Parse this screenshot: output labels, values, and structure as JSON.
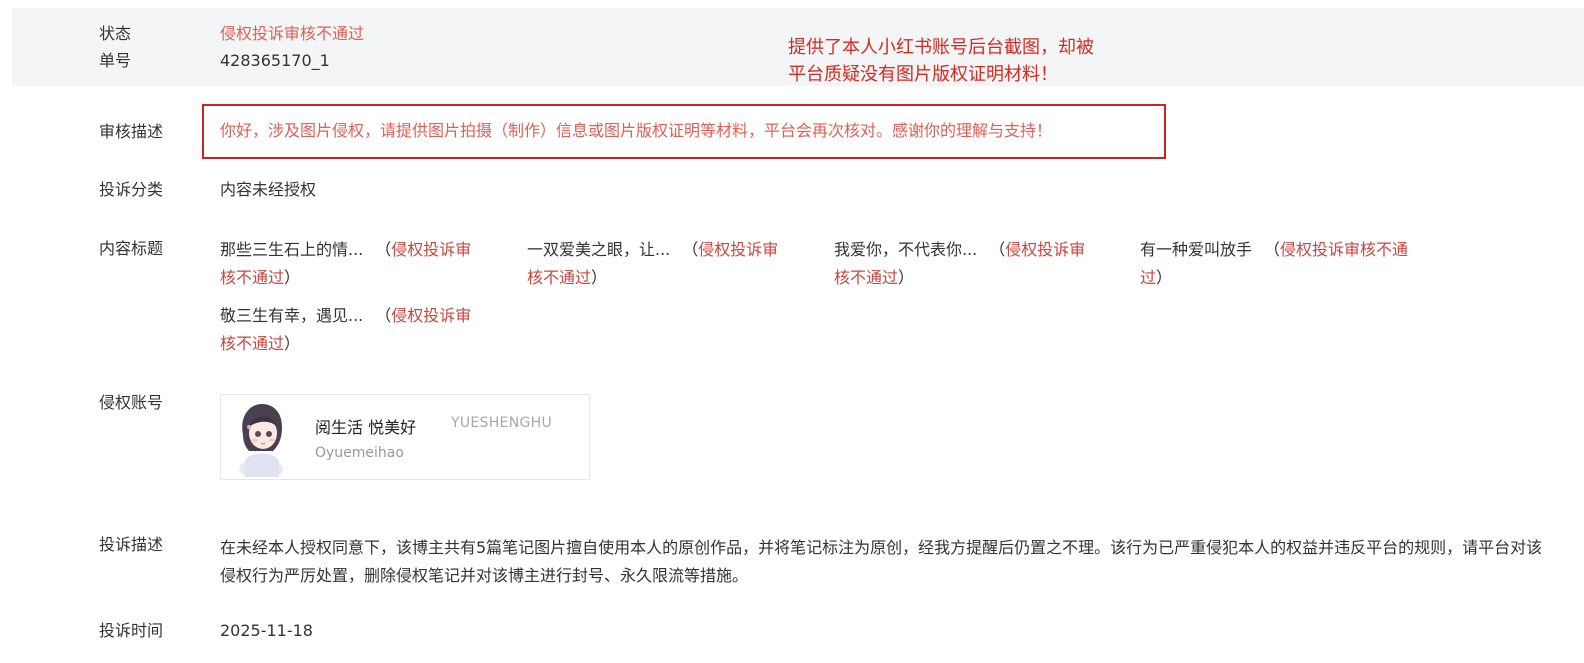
{
  "header": {
    "status_label": "状态",
    "status_value": "侵权投诉审核不通过",
    "order_label": "单号",
    "order_value": "428365170_1",
    "annotation_line1": "提供了本人小红书账号后台截图，却被",
    "annotation_line2": "平台质疑没有图片版权证明材料！"
  },
  "review": {
    "label": "审核描述",
    "text": "你好，涉及图片侵权，请提供图片拍摄（制作）信息或图片版权证明等材料，平台会再次核对。感谢你的理解与支持！"
  },
  "category": {
    "label": "投诉分类",
    "value": "内容未经授权"
  },
  "titles": {
    "label": "内容标题",
    "items": [
      {
        "title": "那些三生石上的情...",
        "status_a": "侵权投诉审",
        "status_b": "核不通过"
      },
      {
        "title": "一双爱美之眼，让...",
        "status_a": "侵权投诉审",
        "status_b": "核不通过"
      },
      {
        "title": "我爱你，不代表你...",
        "status_a": "侵权投诉审",
        "status_b": "核不通过"
      },
      {
        "title": "有一种爱叫放手",
        "status_a": "侵权投诉审核不通",
        "status_b": "过"
      },
      {
        "title": "敬三生有幸，遇见...",
        "status_a": "侵权投诉审",
        "status_b": "核不通过"
      }
    ]
  },
  "account": {
    "label": "侵权账号",
    "name": "阅生活 悦美好",
    "tag": "YUESHENGHU",
    "id": "Oyuemeihao"
  },
  "complaint": {
    "label": "投诉描述",
    "text": "在未经本人授权同意下，该博主共有5篇笔记图片擅自使用本人的原创作品，并将笔记标注为原创，经我方提醒后仍置之不理。该行为已严重侵犯本人的权益并违反平台的规则，请平台对该侵权行为严厉处置，删除侵权笔记并对该博主进行封号、永久限流等措施。"
  },
  "time": {
    "label": "投诉时间",
    "value": "2025-11-18"
  }
}
